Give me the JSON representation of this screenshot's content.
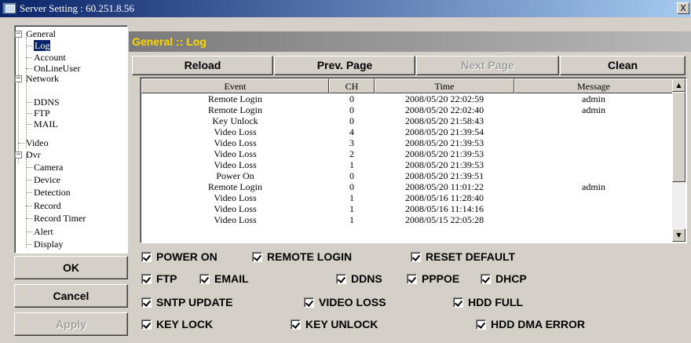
{
  "window": {
    "title": "Server Setting : 60.251.8.56",
    "close_glyph": "X"
  },
  "tree": {
    "items": [
      {
        "label": "General",
        "expander": "−"
      },
      {
        "label": "Log"
      },
      {
        "label": "Account"
      },
      {
        "label": "OnLineUser"
      },
      {
        "label": "Network",
        "expander": "−"
      },
      {
        "label": "DDNS"
      },
      {
        "label": "FTP"
      },
      {
        "label": "MAIL"
      },
      {
        "label": "Video"
      },
      {
        "label": "Dvr",
        "expander": "−"
      },
      {
        "label": "Camera"
      },
      {
        "label": "Device"
      },
      {
        "label": "Detection"
      },
      {
        "label": "Record"
      },
      {
        "label": "Record Timer"
      },
      {
        "label": "Alert"
      },
      {
        "label": "Display"
      }
    ]
  },
  "buttons": {
    "ok": "OK",
    "cancel": "Cancel",
    "apply": "Apply"
  },
  "section_title": "General :: Log",
  "toolbar": {
    "reload": "Reload",
    "prev": "Prev. Page",
    "next": "Next Page",
    "clean": "Clean"
  },
  "table": {
    "headers": [
      "Event",
      "CH",
      "Time",
      "Message"
    ],
    "rows": [
      [
        "Remote Login",
        "0",
        "2008/05/20 22:02:59",
        "admin"
      ],
      [
        "Remote Login",
        "0",
        "2008/05/20 22:02:40",
        "admin"
      ],
      [
        "Key Unlock",
        "0",
        "2008/05/20 21:58:43",
        ""
      ],
      [
        "Video Loss",
        "4",
        "2008/05/20 21:39:54",
        ""
      ],
      [
        "Video Loss",
        "3",
        "2008/05/20 21:39:53",
        ""
      ],
      [
        "Video Loss",
        "2",
        "2008/05/20 21:39:53",
        ""
      ],
      [
        "Video Loss",
        "1",
        "2008/05/20 21:39:53",
        ""
      ],
      [
        "Power On",
        "0",
        "2008/05/20 21:39:51",
        ""
      ],
      [
        "Remote Login",
        "0",
        "2008/05/20 11:01:22",
        "admin"
      ],
      [
        "Video Loss",
        "1",
        "2008/05/16 11:28:40",
        ""
      ],
      [
        "Video Loss",
        "1",
        "2008/05/16 11:14:16",
        ""
      ],
      [
        "Video Loss",
        "1",
        "2008/05/15 22:05:28",
        ""
      ]
    ]
  },
  "filters": [
    {
      "label": "POWER ON",
      "checked": true
    },
    {
      "label": "REMOTE LOGIN",
      "checked": true
    },
    {
      "label": "RESET DEFAULT",
      "checked": true
    },
    {
      "label": "FTP",
      "checked": true
    },
    {
      "label": "EMAIL",
      "checked": true
    },
    {
      "label": "DDNS",
      "checked": true
    },
    {
      "label": "PPPOE",
      "checked": true
    },
    {
      "label": "DHCP",
      "checked": true
    },
    {
      "label": "SNTP UPDATE",
      "checked": true
    },
    {
      "label": "VIDEO LOSS",
      "checked": true
    },
    {
      "label": "HDD FULL",
      "checked": true
    },
    {
      "label": "KEY LOCK",
      "checked": true
    },
    {
      "label": "KEY UNLOCK",
      "checked": true
    },
    {
      "label": "HDD DMA ERROR",
      "checked": true
    }
  ],
  "icons": {
    "window": "app-window-icon",
    "scroll_up": "▲",
    "scroll_down": "▼"
  },
  "colors": {
    "title_start": "#0a246a",
    "title_end": "#a6caf0",
    "section_text": "#ffd700"
  }
}
